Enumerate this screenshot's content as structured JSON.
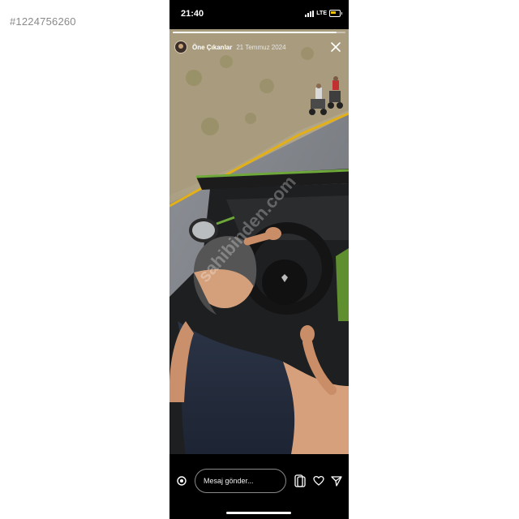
{
  "listing": {
    "id_label": "#1224756260"
  },
  "status_bar": {
    "time": "21:40",
    "network": "LTE",
    "battery_icon": "battery-icon",
    "signal_icon": "signal-icon"
  },
  "story": {
    "author": "Öne Çıkanlar",
    "date": "21 Temmuz 2024",
    "progress": 0.95,
    "close_icon": "close-icon",
    "watermark": "sahibinden.com"
  },
  "footer": {
    "message_placeholder": "Mesaj gönder...",
    "icons": [
      "camera-icon",
      "sticker-icon",
      "heart-icon",
      "send-icon"
    ]
  }
}
